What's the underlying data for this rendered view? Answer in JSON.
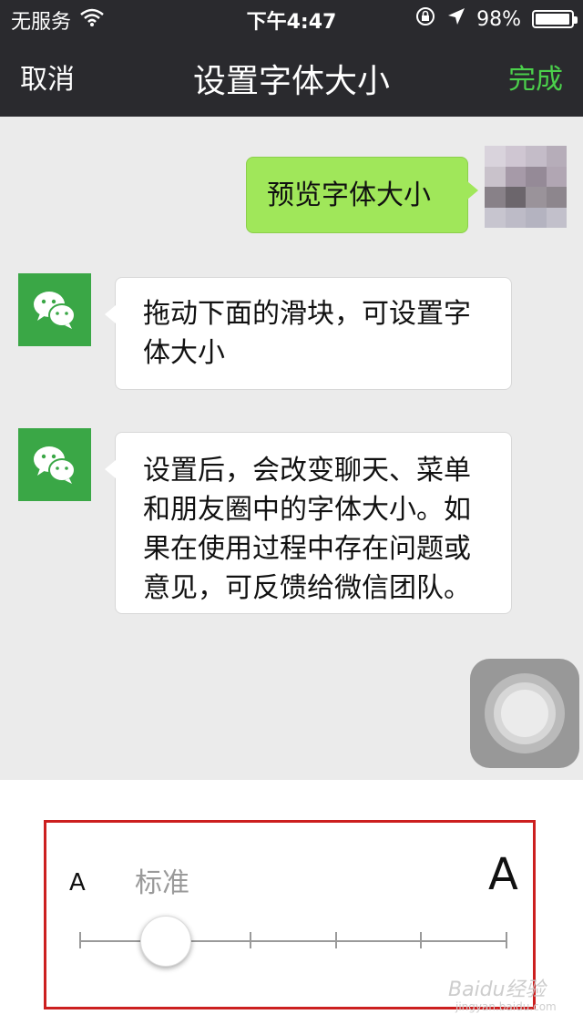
{
  "status_bar": {
    "carrier": "无服务",
    "time": "下午4:47",
    "battery_text": "98%",
    "battery_level": 0.98,
    "icons": [
      "wifi-icon",
      "rotation-lock-icon",
      "location-icon",
      "battery-icon"
    ]
  },
  "nav": {
    "cancel_label": "取消",
    "title": "设置字体大小",
    "done_label": "完成",
    "done_color": "#4bd04b"
  },
  "chat": {
    "preview_message": "预览字体大小",
    "message_1": "拖动下面的滑块，可设置字体大小",
    "message_2": "设置后，会改变聊天、菜单和朋友圈中的字体大小。如果在使用过程中存在问题或意见，可反馈给微信团队。",
    "bubble_green": "#a0e75a",
    "avatar_green": "#3aa746"
  },
  "font_size_panel": {
    "small_label": "A",
    "standard_label": "标准",
    "large_label": "A",
    "slider_steps": 6,
    "slider_selected_index": 1,
    "highlight_color": "#cc1f1f"
  },
  "watermark": {
    "text": "Baidu经验",
    "sub": "jingyan.baidu.com"
  }
}
